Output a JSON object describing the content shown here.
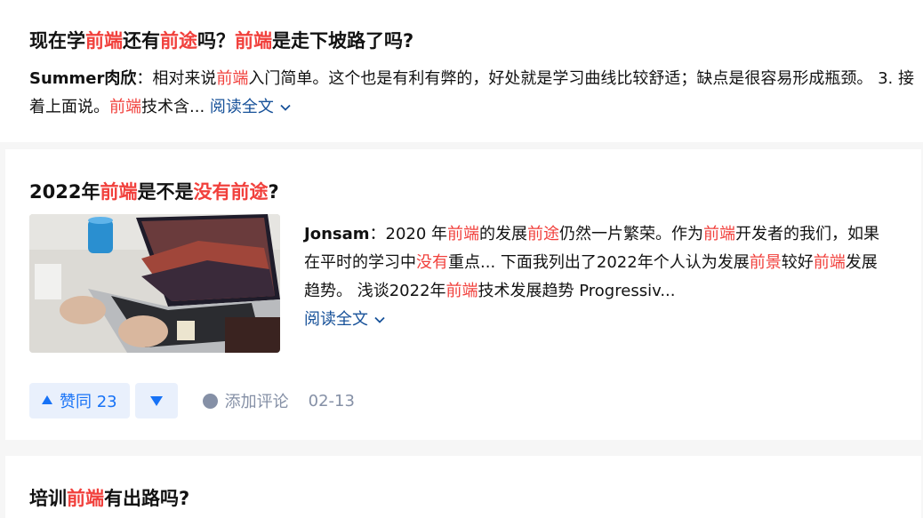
{
  "answers": [
    {
      "title_parts": [
        "现在学",
        "前端",
        "还有",
        "前途",
        "吗？",
        "前端",
        "是走下坡路了吗?"
      ],
      "author": "Summer肉欣",
      "excerpt_parts": [
        "：相对来说",
        "前端",
        "入门简单。这个也是有利有弊的，好处就是学习曲线比较舒适；缺点是很容易形成瓶颈。 3. 接着上面说。",
        "前端",
        "技术含..."
      ],
      "read_more": "阅读全文"
    },
    {
      "title_parts": [
        "2022年",
        "前端",
        "是不是",
        "没有前途",
        "?"
      ],
      "author": "Jonsam",
      "excerpt_parts": [
        "：2020 年",
        "前端",
        "的发展",
        "前途",
        "仍然一片繁荣。作为",
        "前端",
        "开发者的我们，如果在平时的学习中",
        "没有",
        "重点... 下面我列出了2022年个人认为发展",
        "前景",
        "较好",
        "前端",
        "发展趋势。 浅谈2022年",
        "前端",
        "技术发展趋势 Progressiv..."
      ],
      "read_more": "阅读全文",
      "upvote_label": "赞同 23",
      "comment_label": "添加评论",
      "date": "02-13"
    },
    {
      "title_parts": [
        "培训",
        "前端",
        "有出路吗?"
      ]
    }
  ],
  "colors": {
    "highlight": "#f1403c",
    "link": "#175199",
    "vote": "#1772f6",
    "meta": "#8590a6"
  }
}
